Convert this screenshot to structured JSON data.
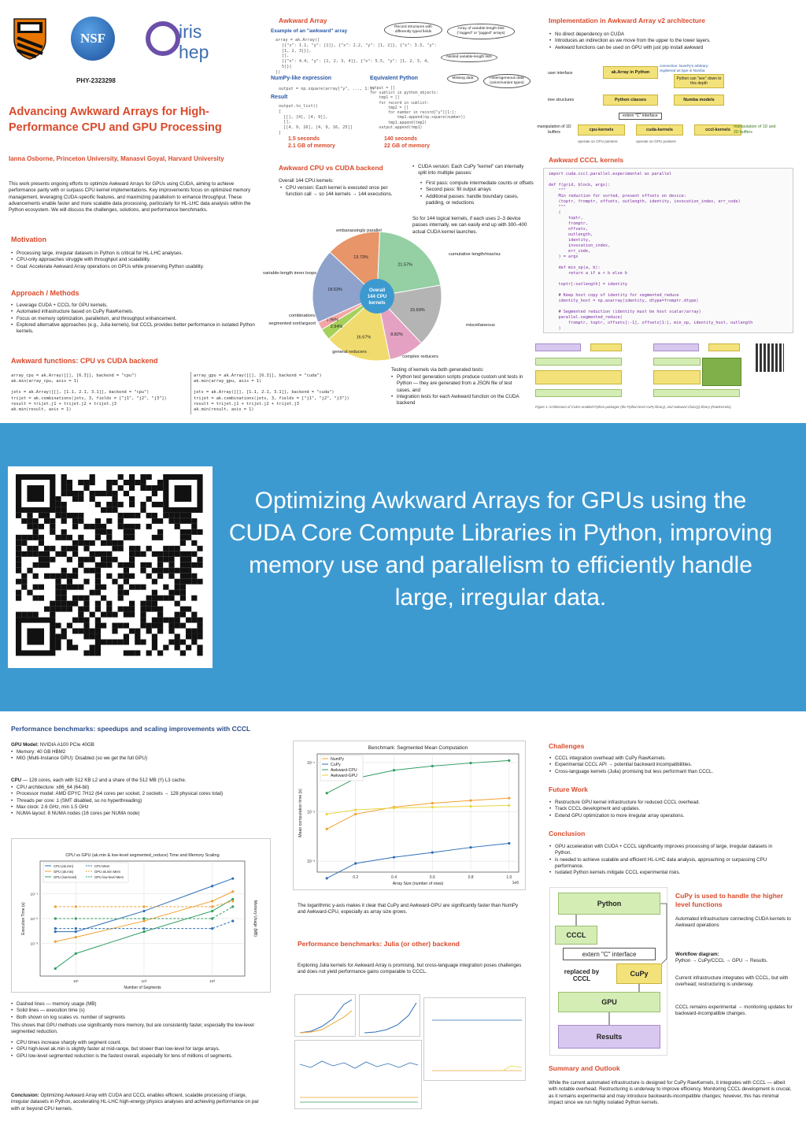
{
  "logos": {
    "princeton": "princeton-shield",
    "nsf": "NSF",
    "iris": "iris",
    "hep": "hep",
    "grant": "PHY-2323298"
  },
  "poster": {
    "title": "Advancing Awkward Arrays for High-Performance CPU and GPU Processing",
    "authors": "Ianna Osborne, Princeton University, Manasvi Goyal, Harvard University",
    "abstract": "This work presents ongoing efforts to optimize Awkward Arrays for GPUs using CUDA, aiming to achieve performance parity with or surpass CPU kernel implementations. Key improvements focus on optimized memory management, leveraging CUDA-specific features, and maximizing parallelism to enhance throughput. These advancements enable faster and more scalable data processing, particularly for HL-LHC data analysis within the Python ecosystem. We will discuss the challenges, solutions, and performance benchmarks.",
    "motivation": {
      "heading": "Motivation",
      "items": [
        "Processing large, irregular datasets in Python is critical for HL-LHC analyses.",
        "CPU-only approaches struggle with throughput and scalability.",
        "Goal: Accelerate Awkward Array operations on GPUs while preserving Python usability."
      ]
    },
    "approach": {
      "heading": "Approach / Methods",
      "items": [
        "Leverage CUDA + CCCL for GPU kernels.",
        "Automated infrastructure based on CuPy RawKernels.",
        "Focus on memory optimization, parallelism, and throughput enhancement.",
        "Explored alternative approaches (e.g., Julia kernels), but CCCL provides better performance in isolated Python kernels."
      ]
    },
    "functions": {
      "heading": "Awkward functions: CPU vs CUDA backend",
      "cpu_code": "array_cpu = ak.Array([[], [6.3]], backend = \"cpu\")\nak.min(array_cpu, axis = 1)\n\njets = ak.Array([[], [1.1, 2.1, 3.1]], backend = \"cpu\")\ntrijet = ak.combinations(jets, 3, fields = [\"j1\", \"j2\", \"j3\"])\nresult = trijet.j1 + trijet.j2 + trijet.j3\nak.min(result, axis = 1)",
      "gpu_code": "array_gpu = ak.Array([[], [6.3]], backend = \"cuda\")\nak.min(array_gpu, axis = 1)\n\njets = ak.Array([[], [1.1, 2.1, 3.1]], backend = \"cuda\")\ntrijet = ak.combinations(jets, 3, fields = [\"j1\", \"j2\", \"j3\"])\nresult = trijet.j1 + trijet.j2 + trijet.j3\nak.min(result, axis = 1)"
    },
    "awkward_array": {
      "heading": "Awkward Array",
      "example_label": "Example of an \"awkward\" array",
      "bubble1": "Record structures with differently typed fields",
      "bubble2": "Array of variable-length lists (\"ragged\" or \"jagged\" arrays)",
      "bubble3": "Nested variable-length lists",
      "bubble4": "Missing data",
      "bubble5": "Heterogeneous data (union/variant types)",
      "numpy_heading": "NumPy-like expression",
      "python_heading": "Equivalent Python",
      "result_label": "Result",
      "numpy_time": "1.5 seconds",
      "numpy_mem": "2.1 GB of memory",
      "python_time": "140 seconds",
      "python_mem": "22 GB of memory"
    },
    "cpu_vs_cuda": {
      "heading": "Awkward CPU vs CUDA backend",
      "overall": "Overall 144 CPU kernels:",
      "cpu_version": "CPU version: Each kernel is executed once per function call → so 144 kernels → 144 executions.",
      "cuda_version": "CUDA version: Each CuPy \"kernel\" can internally split into multiple passes:",
      "cuda_items": [
        "First pass: compute intermediate counts or offsets",
        "Second pass: fill output arrays",
        "Additional passes: handle boundary cases, padding, or reductions"
      ],
      "so_for": "So for 144 logical kernels, if each uses 2–3 device passes internally, we can easily end up with 300–400 actual CUDA kernel launches.",
      "testing": "Testing of kernels via both generated tests:",
      "testing_items": [
        "Python test generation scripts produce custom unit tests in Python — they are generated from a JSON file of test cases, and",
        "integration tests for each Awkward function on the CUDA backend"
      ]
    },
    "implementation": {
      "heading": "Implementation in Awkward Array v2 architecture",
      "items": [
        "No direct dependency on CUDA",
        "Introduces an indirection as we move from the upper to the lower layers.",
        "Awkward functions can be used on GPU with just pip install awkward"
      ],
      "user_interface": "user interface",
      "ak_array": "ak.Array in Python",
      "tree_structures": "tree structures",
      "python_classes": "Python classes",
      "numba_models": "Numba models",
      "extern_c": "extern \"C\" interface",
      "manip_1d": "manipulation of 1D buffers",
      "cpu_kernels": "cpu-kernels",
      "cuda_kernels": "cuda-kernels",
      "cccl_kernels": "cccl-kernels",
      "manip_right": "manipulation of 1D and 2D buffers",
      "python_see": "Python can \"see\" down to this depth",
      "connection_note": "connection: NumPy's arbitrary-registered as type in Numba",
      "cpu_pointers": "operate on CPU pointers",
      "gpu_pointers": "operate on GPU pointers"
    },
    "cccl_kernels": {
      "heading": "Awkward CCCL kernels",
      "code": "import cuda.cccl.parallel.experimental as parallel\n\ndef f(grid, block, args):\n    \"\"\"\n    Min reduction for sorted, present offsets on device:\n    (toptr, fromptr, offsets, outlength, identity, invocation_index, err_code)\n    \"\"\"\n    (\n        toptr,\n        fromptr,\n        offsets,\n        outlength,\n        identity,\n        invocation_index,\n        err_code,\n    ) = args\n\n    def min_op(a, b):\n        return a if a < b else b\n\n    toptr[:outlength] = identity\n\n    # Keep host copy of identity for segmented_reduce\n    identity_host = np.asarray(identity, dtype=fromptr.dtype)\n\n    # Segmented reduction (identity must be host scalar/array)\n    parallel.segmented_reduce(\n        fromptr, toptr, offsets[:-1], offsets[1:], min_op, identity_host, outlength\n    )",
      "fig_caption": "Figure 1: Architecture of CUDA-enabled Python packages (the Python-level CuPy library), and Awkward Cfunc(y) library (RawKernels)."
    },
    "banner": {
      "text": "Optimizing Awkward Arrays for GPUs using the CUDA Core Compute Libraries in Python, improving memory use and parallelism to efficiently handle large, irregular data."
    },
    "perf": {
      "heading": "Performance benchmarks: speedups and scaling improvements with CCCL",
      "gpu_model_label": "GPU Model:",
      "gpu_model": "NVIDIA A100 PCIe 40GB",
      "gpu_items": [
        "Memory: 40 GB HBM2",
        "MIG (Multi-Instance GPU): Disabled (so we get the full GPU)"
      ],
      "cpu_label": "CPU",
      "cpu_line": "— 128 cores, each with 512 KB L2 and a share of the 512 MB (!!) L3 cache.",
      "cpu_items": [
        "CPU architecture: x86_64 (64-bit)",
        "Processor model: AMD EPYC 7H12 (64 cores per socket, 2 sockets → 128 physical cores total)",
        "Threads per core: 1 (SMT disabled, so no hyperthreading)",
        "Max clock: 2.6 GHz, min 1.5 GHz",
        "NUMA layout: 8 NUMA nodes (16 cores per NUMA node)"
      ],
      "legend_items": [
        "Dashed lines — memory usage (MB)",
        "Solid lines — execution time (s)",
        "Both shown on log scales vs. number of segments"
      ],
      "legend_note": "This shows that GPU methods use significantly more memory, but are consistently faster, especially the low-level segmented reduction.",
      "obs_items": [
        "CPU times increase sharply with segment count.",
        "GPU high-level ak.min is slightly faster at mid-range, but slower than low-level for large arrays.",
        "GPU low-level segmented reduction is the fastest overall, especially for tens of millions of segments."
      ],
      "conclusion_label": "Conclusion:",
      "conclusion": "Optimizing Awkward Array with CUDA and CCCL enables efficient, scalable processing of large, irregular datasets in Python, accelerating HL-LHC high-energy physics analyses and achieving performance on par with or beyond CPU kernels."
    },
    "mid": {
      "log_note": "The logarithmic y-axis makes it clear that CuPy and Awkward-GPU are significantly faster than NumPy and Awkward-CPU, especially as array size grows.",
      "julia_heading": "Performance benchmarks: Julia (or other) backend",
      "julia_text": "Exploring Julia kernels for Awkward Array is promising, but cross-language integration poses challenges and does not yield performance gains comparable to CCCL."
    },
    "right": {
      "challenges_heading": "Challenges",
      "challenges": [
        "CCCL integration overhead with CuPy RawKernels.",
        "Experimental CCCL API → potential backward incompatibilities.",
        "Cross-language kernels (Julia) promising but less performant than CCCL."
      ],
      "future_heading": "Future Work",
      "future": [
        "Restructure GPU kernel infrastructure for reduced CCCL overhead.",
        "Track CCCL development and updates.",
        "Extend GPU optimization to more irregular array operations."
      ],
      "conclusion_heading": "Conclusion",
      "conclusion": [
        "GPU acceleration with CUDA + CCCL significantly improves processing of large, irregular datasets in Python.",
        "is needed to achieve scalable and efficient HL-LHC data analysis, approaching or surpassing CPU performance.",
        "Isolated Python kernels mitigate CCCL experimental risks."
      ],
      "flow": {
        "python": "Python",
        "cccl": "CCCL",
        "extern": "extern \"C\" interface",
        "replaced_by": "replaced by CCCL",
        "cupy": "CuPy",
        "gpu": "GPU",
        "results": "Results"
      },
      "cupy_heading": "CuPy is used to handle the higher level functions",
      "cupy_text": "Automated infrastructure connecting CUDA kernels to Awkward operations",
      "workflow_label": "Workflow diagram:",
      "workflow": "Python → CuPy/CCCL → GPU → Results.",
      "current": "Current infrastructure integrates with CCCL, but with overhead; restructuring is underway.",
      "experimental": "CCCL remains experimental → monitoring updates for backward-incompatible changes.",
      "summary_heading": "Summary and Outlook",
      "summary": "While the current automated infrastructure is designed for CuPy RawKernels, it integrates with CCCL — albeit with notable overhead. Restructuring is underway to improve efficiency. Monitoring CCCL development is crucial, as it remains experimental and may introduce backwards-incompatible changes; however, this has minimal impact since we run highly isolated Python kernels."
    }
  },
  "chart_data": [
    {
      "type": "pie",
      "title": "",
      "center_label": "Overall 144 CPU kernels",
      "slices": [
        {
          "label": "embarassingly parallel",
          "value": 13.73,
          "color": "#e8956a"
        },
        {
          "label": "cumulative length/max/sum",
          "value": 21.57,
          "color": "#95cfa4"
        },
        {
          "label": "miscellaneous",
          "value": 15.69,
          "color": "#b4b4b4"
        },
        {
          "label": "complex reducers",
          "value": 8.82,
          "color": "#e4a1c2"
        },
        {
          "label": "general reducers",
          "value": 16.67,
          "color": "#f0dc6e"
        },
        {
          "label": "segmented sort/argsort",
          "value": 2.94,
          "color": "#a6d05a"
        },
        {
          "label": "combinations",
          "value": 1.96,
          "color": "#f4a6a6"
        },
        {
          "label": "variable-length inner loops",
          "value": 18.63,
          "color": "#8ea2cc"
        }
      ]
    },
    {
      "type": "line",
      "title": "Benchmark: Segmented Mean Computation",
      "xlabel": "Array Size (number of rows)",
      "ylabel": "Mean computation time (s)",
      "x_multiplier": "1e6",
      "yscale": "log",
      "x": [
        0.05,
        0.2,
        0.4,
        0.6,
        0.8,
        1.0
      ],
      "xlim": [
        0,
        1.05
      ],
      "ylim": [
        0.0006,
        0.15
      ],
      "xticks": [
        0.2,
        0.4,
        0.6,
        0.8,
        1.0
      ],
      "yticks": [
        0.001,
        0.01,
        0.1
      ],
      "ytick_labels": [
        "10⁻³",
        "10⁻²",
        "10⁻¹"
      ],
      "grid": true,
      "legend_position": "top-left",
      "series": [
        {
          "name": "NumPy",
          "values": [
            0.0045,
            0.009,
            0.0125,
            0.015,
            0.017,
            0.019
          ],
          "color": "#f0a030"
        },
        {
          "name": "CuPy",
          "values": [
            0.00045,
            0.0009,
            0.0012,
            0.0015,
            0.0019,
            0.0023
          ],
          "color": "#2e6fb5"
        },
        {
          "name": "Awkward-CPU",
          "values": [
            0.024,
            0.048,
            0.07,
            0.085,
            0.098,
            0.11
          ],
          "color": "#2f9e62"
        },
        {
          "name": "Awkward-GPU",
          "values": [
            0.009,
            0.011,
            0.012,
            0.0125,
            0.013,
            0.0135
          ],
          "color": "#e8d642"
        }
      ]
    },
    {
      "type": "line",
      "title": "CPU vs GPU (ak.min & low-level segmented_reduce) Time and Memory Scaling",
      "xlabel": "Number of Segments",
      "ylabel": "Execution Time (s)",
      "y2label": "Memory Usage (MB)",
      "xscale": "log",
      "yscale": "log",
      "x": [
        5,
        10,
        100,
        1000,
        2000
      ],
      "xlim": [
        3,
        3000
      ],
      "ylim": [
        5e-05,
        2
      ],
      "xticks": [
        10,
        100,
        1000
      ],
      "xtick_labels": [
        "10¹",
        "10²",
        "10³"
      ],
      "yticks": [
        0.001,
        0.01,
        0.1
      ],
      "ytick_labels": [
        "10⁻³",
        "10⁻²",
        "10⁻¹"
      ],
      "grid": true,
      "legend_position": "top-left",
      "series": [
        {
          "name": "CPU (ak.min)",
          "values": [
            0.003,
            0.003,
            0.02,
            0.2,
            0.4
          ],
          "color": "#2e6fb5"
        },
        {
          "name": "GPU (ak.min)",
          "values": [
            0.0012,
            0.0018,
            0.008,
            0.05,
            0.12
          ],
          "color": "#f0a030"
        },
        {
          "name": "GPU (low-level)",
          "values": [
            0.0001,
            0.0004,
            0.003,
            0.02,
            0.06
          ],
          "color": "#2f9e62"
        },
        {
          "name": "CPU Mem",
          "values": [
            0.004,
            0.004,
            0.004,
            0.004,
            0.008
          ],
          "color": "#2e6fb5",
          "dashed": true
        },
        {
          "name": "GPU ak.min Mem",
          "values": [
            0.03,
            0.03,
            0.03,
            0.03,
            0.05
          ],
          "color": "#f0a030",
          "dashed": true
        },
        {
          "name": "GPU low-level Mem",
          "values": [
            0.01,
            0.01,
            0.01,
            0.01,
            0.03
          ],
          "color": "#2f9e62",
          "dashed": true
        }
      ]
    }
  ]
}
